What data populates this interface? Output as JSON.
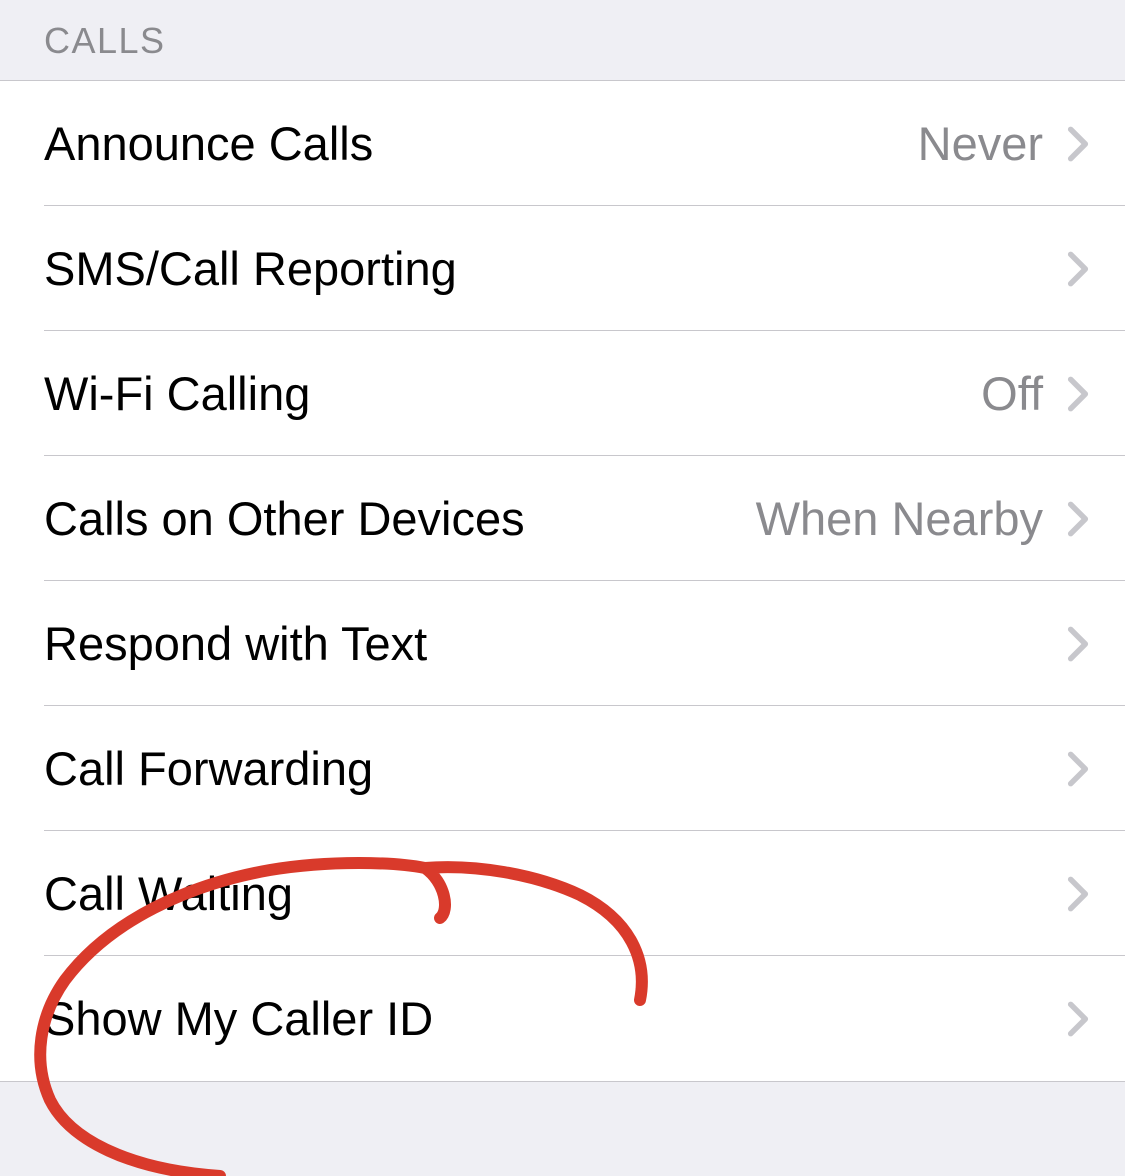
{
  "section": {
    "header": "CALLS",
    "rows": [
      {
        "label": "Announce Calls",
        "value": "Never"
      },
      {
        "label": "SMS/Call Reporting",
        "value": ""
      },
      {
        "label": "Wi-Fi Calling",
        "value": "Off"
      },
      {
        "label": "Calls on Other Devices",
        "value": "When Nearby"
      },
      {
        "label": "Respond with Text",
        "value": ""
      },
      {
        "label": "Call Forwarding",
        "value": ""
      },
      {
        "label": "Call Waiting",
        "value": ""
      },
      {
        "label": "Show My Caller ID",
        "value": ""
      }
    ]
  },
  "colors": {
    "separator": "#c8c7cc",
    "groupedBackground": "#efeff4",
    "secondaryLabel": "#8a8a8e",
    "annotation": "#d93a2b"
  }
}
